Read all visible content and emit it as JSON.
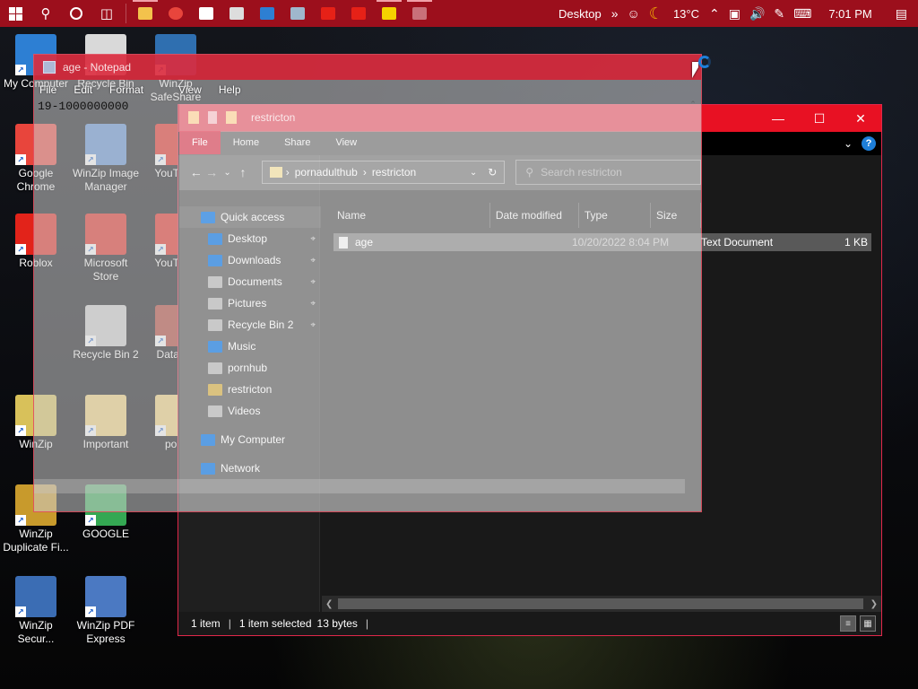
{
  "taskbar": {
    "desktop_label": "Desktop",
    "temperature": "13°C",
    "time": "7:01 PM",
    "colors": {
      "background": "#9c0f1c"
    }
  },
  "desktop_icons": [
    {
      "label": "My Computer",
      "color": "#2d7fd3"
    },
    {
      "label": "Recycle Bin",
      "color": "#d9d9d9"
    },
    {
      "label": "WinZip SafeShare",
      "color": "#2f6fb0"
    },
    {
      "label": "Google Chrome",
      "color": "#e8453c"
    },
    {
      "label": "WinZip Image Manager",
      "color": "#5b8fd6"
    },
    {
      "label": "YouTube",
      "color": "#e62117"
    },
    {
      "label": "Roblox",
      "color": "#e2231a"
    },
    {
      "label": "Microsoft Store",
      "color": "#e2231a"
    },
    {
      "label": "YouTube",
      "color": "#e62117"
    },
    {
      "label": "Recycle Bin 2",
      "color": "#cfcfcf"
    },
    {
      "label": "DataWa",
      "color": "#b03a2e"
    },
    {
      "label": "WinZip",
      "color": "#d8c15a"
    },
    {
      "label": "Important",
      "color": "#f3d37b"
    },
    {
      "label": "porn",
      "color": "#f3d37b"
    },
    {
      "label": "WinZip Duplicate Fi...",
      "color": "#c89a2c"
    },
    {
      "label": "GOOGLE",
      "color": "#34a853"
    },
    {
      "label": "WinZip Secur...",
      "color": "#3b6db4"
    },
    {
      "label": "WinZip PDF Express",
      "color": "#4b79c2"
    }
  ],
  "notepad": {
    "title": "age - Notepad",
    "menu": [
      "File",
      "Edit",
      "Format",
      "View",
      "Help"
    ],
    "content": "19-1000000000"
  },
  "explorer": {
    "title": "restricton",
    "tabs": [
      "File",
      "Home",
      "Share",
      "View"
    ],
    "path": [
      "pornadulthub",
      "restricton"
    ],
    "search_placeholder": "Search restricton",
    "nav": [
      {
        "label": "Quick access",
        "icon": "star-icon",
        "color": "#4aa3ff",
        "pinned": false
      },
      {
        "label": "Desktop",
        "icon": "desktop-icon",
        "color": "#4aa3ff",
        "pinned": true
      },
      {
        "label": "Downloads",
        "icon": "download-icon",
        "color": "#4aa3ff",
        "pinned": true
      },
      {
        "label": "Documents",
        "icon": "document-icon",
        "color": "#dcdcdc",
        "pinned": true
      },
      {
        "label": "Pictures",
        "icon": "picture-icon",
        "color": "#dcdcdc",
        "pinned": true
      },
      {
        "label": "Recycle Bin 2",
        "icon": "recycle-bin-icon",
        "color": "#dcdcdc",
        "pinned": true
      },
      {
        "label": "Music",
        "icon": "music-icon",
        "color": "#4aa3ff",
        "pinned": false
      },
      {
        "label": "pornhub",
        "icon": "folder-icon",
        "color": "#dcdcdc",
        "pinned": false
      },
      {
        "label": "restricton",
        "icon": "folder-icon",
        "color": "#f3d37b",
        "pinned": false
      },
      {
        "label": "Videos",
        "icon": "video-icon",
        "color": "#dcdcdc",
        "pinned": false
      },
      {
        "label": "My Computer",
        "icon": "computer-icon",
        "color": "#4aa3ff",
        "pinned": false
      },
      {
        "label": "Network",
        "icon": "network-icon",
        "color": "#4aa3ff",
        "pinned": false
      }
    ],
    "columns": [
      "Name",
      "Date modified",
      "Type",
      "Size"
    ],
    "files": [
      {
        "name": "age",
        "date": "10/20/2022 8:04 PM",
        "type": "Text Document",
        "size": "1 KB"
      }
    ],
    "status": {
      "count": "1 item",
      "selected": "1 item selected",
      "size": "13 bytes"
    }
  }
}
